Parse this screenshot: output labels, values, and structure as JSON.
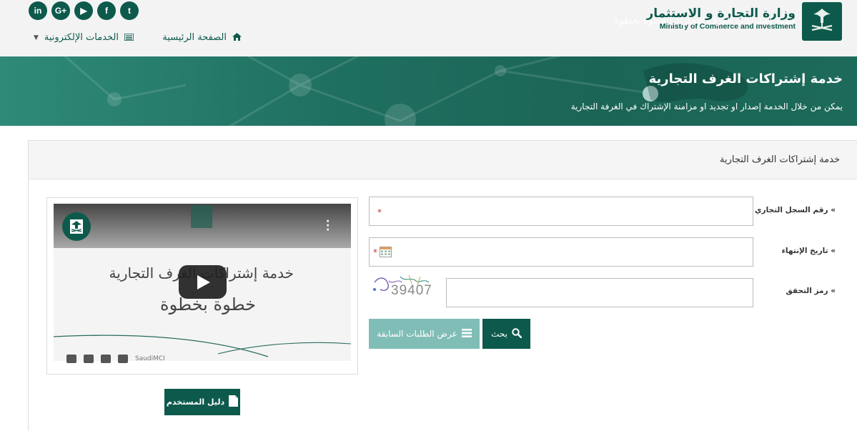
{
  "header": {
    "ministry_ar": "وزارة التجارة و الاستثمار",
    "ministry_en": "Ministry of Commerce and Investment",
    "social": [
      {
        "name": "linkedin-icon",
        "glyph": "in"
      },
      {
        "name": "google-plus-icon",
        "glyph": "G+"
      },
      {
        "name": "youtube-icon",
        "glyph": "▶"
      },
      {
        "name": "facebook-icon",
        "glyph": "f"
      },
      {
        "name": "twitter-icon",
        "glyph": "t"
      }
    ],
    "nav": {
      "home": "الصفحة الرئيسية",
      "eservices": "الخدمات الإلكترونية"
    }
  },
  "banner": {
    "title": "خدمة إشتراكات الغرف التجارية",
    "subtitle": "يمكن من خلال الخدمة إصدار او تجديد او مزامنة الإشتراك في الغرفة التجارية"
  },
  "panel": {
    "title": "خدمة إشتراكات الغرف التجارية"
  },
  "form": {
    "cr_label": "» رقم السجل التجاري",
    "cr_value": "",
    "expiry_label": "» تاريخ الإنتهاء",
    "expiry_value": "",
    "captcha_label": "» رمز التحقق",
    "captcha_text": "39407",
    "captcha_value": "",
    "required_mark": "*"
  },
  "buttons": {
    "search": "بحث",
    "history": "عرض الطلبات السابقة",
    "guide": "دليل المستخدم"
  },
  "video": {
    "title": "خدمة إشتراكات الغرف التجارية | خطوة بخطوة",
    "headline": "خدمة إشتراكات الغرف التجارية",
    "subheadline": "خطوة بخطوة",
    "footer_handle": "SaudiMCI"
  },
  "colors": {
    "brand": "#0d5a4c",
    "accent_light": "#80bdb6"
  }
}
